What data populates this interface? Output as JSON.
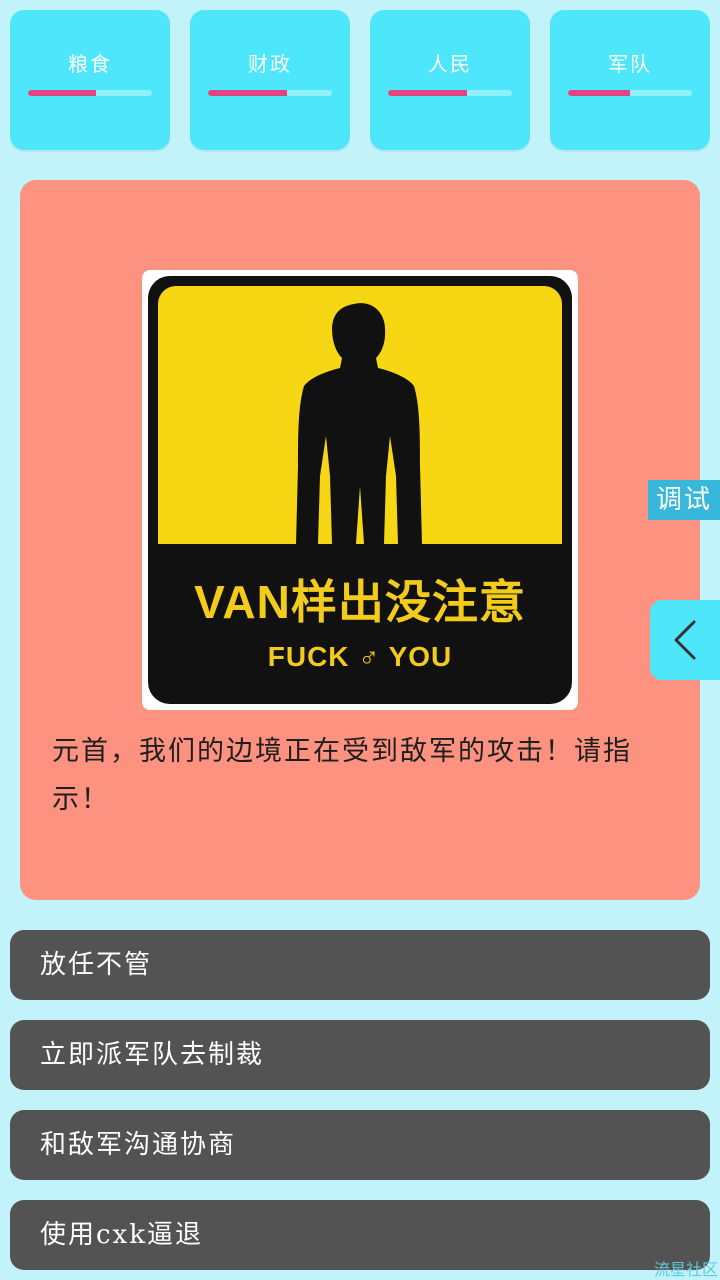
{
  "stats": [
    {
      "label": "粮食",
      "level": 0.55
    },
    {
      "label": "财政",
      "level": 0.64
    },
    {
      "label": "人民",
      "level": 0.64
    },
    {
      "label": "军队",
      "level": 0.5
    }
  ],
  "event": {
    "image": {
      "title": "VAN样出没注意",
      "subtitle": "FUCK ♂ YOU"
    },
    "text": "元首，我们的边境正在受到敌军的攻击！请指示！"
  },
  "choices": [
    {
      "label": "放任不管"
    },
    {
      "label": "立即派军队去制裁"
    },
    {
      "label": "和敌军沟通协商"
    },
    {
      "label": "使用cxk逼退"
    }
  ],
  "debug_label": "调试",
  "watermark": "流星社区",
  "colors": {
    "background": "#c2f3fb",
    "stat_card": "#4ee6fb",
    "stat_fill": "#e0457f",
    "event_card": "#fe9280",
    "choice_button": "#535353",
    "sign_yellow": "#f7d713"
  }
}
